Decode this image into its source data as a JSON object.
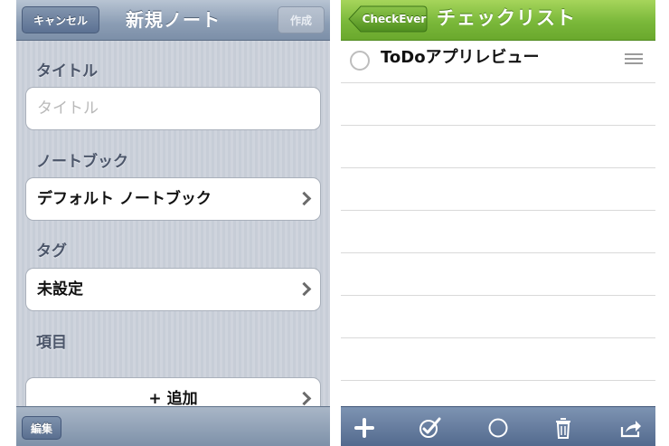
{
  "left": {
    "nav": {
      "cancel": "キャンセル",
      "title": "新規ノート",
      "create": "作成"
    },
    "sections": {
      "title_label": "タイトル",
      "title_placeholder": "タイトル",
      "notebook_label": "ノートブック",
      "notebook_value": "デフォルト ノートブック",
      "tag_label": "タグ",
      "tag_value": "未設定",
      "items_label": "項目",
      "add_label": "+ 追加"
    },
    "toolbar": {
      "edit": "編集"
    }
  },
  "right": {
    "nav": {
      "back": "CheckEver",
      "title": "チェックリスト"
    },
    "items": [
      {
        "label": "ToDoアプリレビュー",
        "checked": false
      }
    ],
    "toolbar_icons": [
      "plus-icon",
      "checkmark-circle-icon",
      "circle-icon",
      "trash-icon",
      "share-icon"
    ]
  },
  "colors": {
    "green_nav": "#7ab83a",
    "blue_toolbar": "#52698d"
  }
}
